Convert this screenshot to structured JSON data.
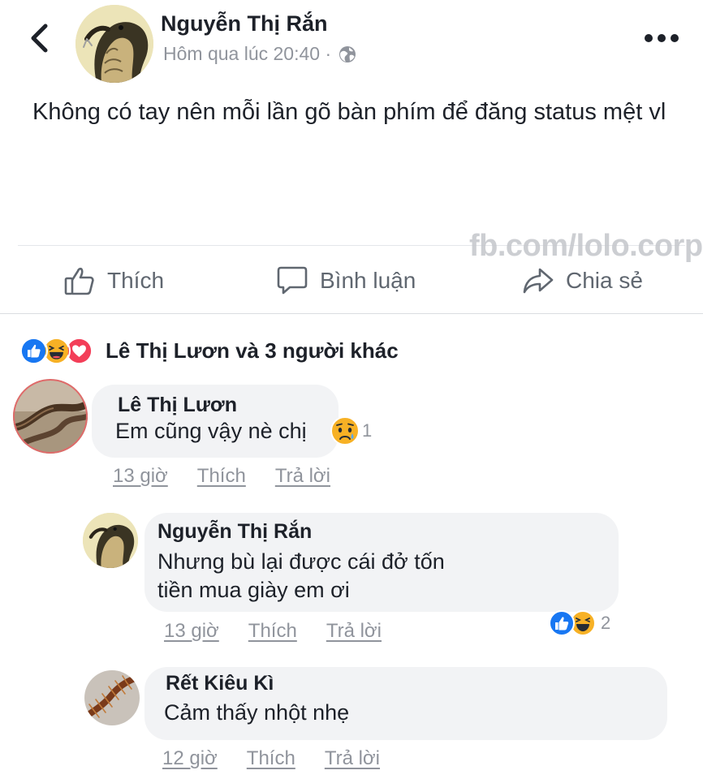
{
  "post": {
    "author": "Nguyễn Thị Rắn",
    "timestamp": "Hôm qua lúc 20:40 ·",
    "privacy_icon": "globe-icon",
    "text": "Không có tay nên mỗi lần gõ bàn phím để đăng status mệt vl",
    "watermark": "fb.com/lolo.corp"
  },
  "actions": {
    "like": "Thích",
    "comment": "Bình luận",
    "share": "Chia sẻ"
  },
  "reactions": {
    "summary": "Lê Thị Lươn và 3 người khác",
    "icons": [
      "like-icon",
      "haha-icon",
      "love-icon"
    ]
  },
  "comments": [
    {
      "author": "Lê Thị Lươn",
      "text": "Em cũng vậy nè chị",
      "reaction_count": "1",
      "time": "13 giờ",
      "like": "Thích",
      "reply": "Trả lời"
    },
    {
      "author": "Nguyễn Thị Rắn",
      "text_line1": "Nhưng bù lại được cái đở tốn",
      "text_line2": "tiền mua giày em ơi",
      "reaction_count": "2",
      "time": "13 giờ",
      "like": "Thích",
      "reply": "Trả lời"
    },
    {
      "author": "Rết Kiêu Kì",
      "text": "Cảm thấy nhột nhẹ",
      "time": "12 giờ",
      "like": "Thích",
      "reply": "Trả lời"
    }
  ],
  "colors": {
    "like_blue": "#1877f2",
    "haha_yellow": "#f7b125",
    "love_red": "#f33e58",
    "secondary_text": "#90949c",
    "bubble_bg": "#f2f3f5"
  }
}
